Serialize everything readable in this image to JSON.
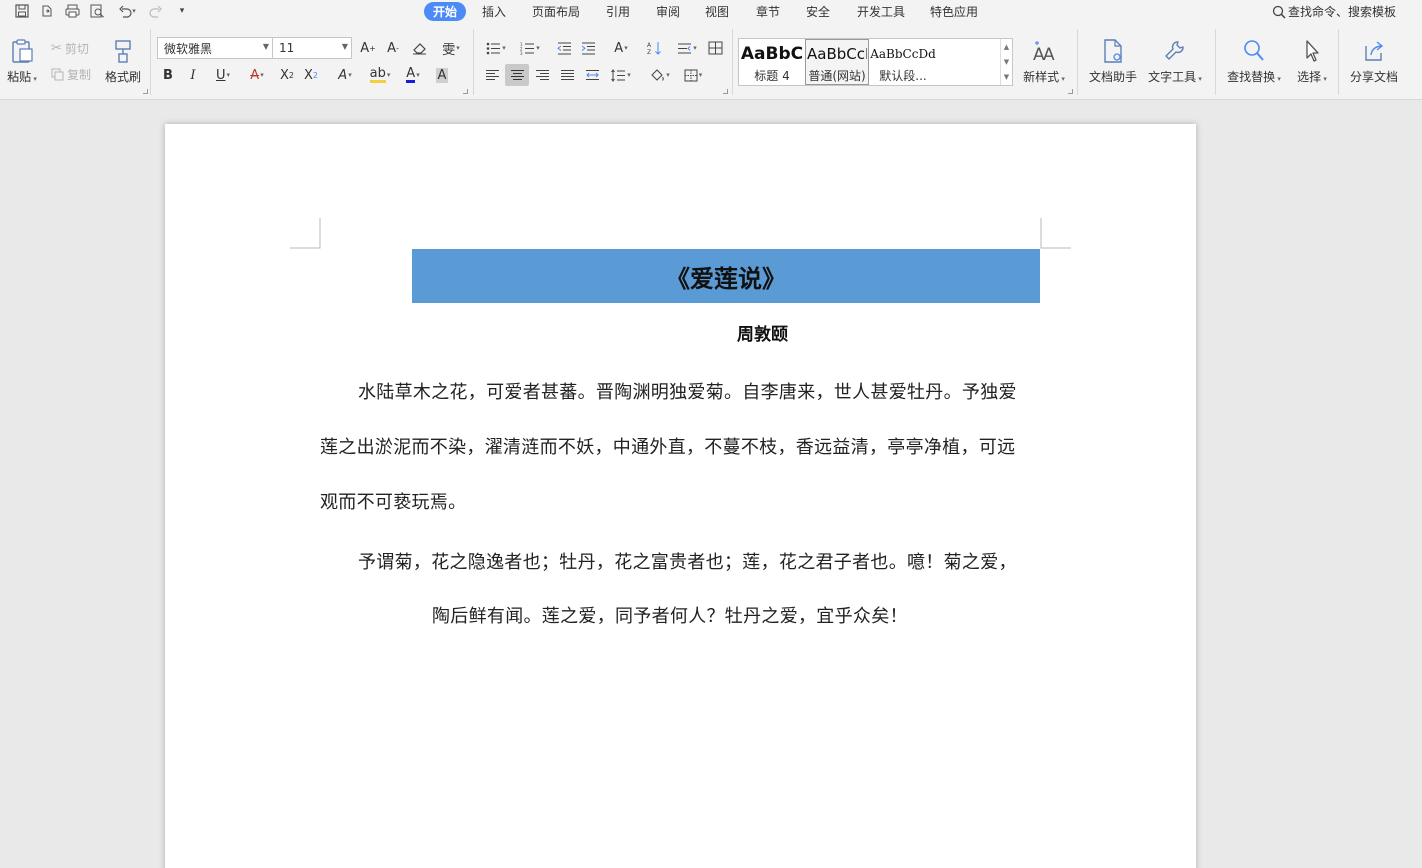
{
  "menu": {
    "tabs": [
      "开始",
      "插入",
      "页面布局",
      "引用",
      "审阅",
      "视图",
      "章节",
      "安全",
      "开发工具",
      "特色应用"
    ],
    "active_tab": "开始",
    "search_command": "查找命令、搜索模板"
  },
  "ribbon": {
    "clipboard": {
      "paste": "粘贴",
      "cut": "剪切",
      "copy": "复制",
      "format_painter": "格式刷"
    },
    "font": {
      "name": "微软雅黑",
      "size": "11"
    },
    "styles": [
      {
        "sample": "AaBbC",
        "name": "标题 4"
      },
      {
        "sample": "AaBbCcI",
        "name": "普通(网站)"
      },
      {
        "sample": "AaBbCcDd",
        "name": "默认段..."
      }
    ],
    "new_style": "新样式",
    "doc_assistant": "文档助手",
    "text_tools": "文字工具",
    "find_replace": "查找替换",
    "select": "选择",
    "share_doc": "分享文档"
  },
  "document": {
    "title": "《爱莲说》",
    "author": "周敦颐",
    "paragraph1": [
      "水陆草木之花，可爱者甚蕃。晋陶渊明独爱菊。自李唐来，世人甚爱牡丹。予独爱",
      "莲之出淤泥而不染，濯清涟而不妖，中通外直，不蔓不枝，香远益清，亭亭净植，可远",
      "观而不可亵玩焉。"
    ],
    "paragraph2": [
      "予谓菊，花之隐逸者也；牡丹，花之富贵者也；莲，花之君子者也。噫！菊之爱，",
      "陶后鲜有闻。莲之爱，同予者何人？牡丹之爱，宜乎众矣！"
    ],
    "title_bg_color": "#5b9bd5"
  },
  "colors": {
    "active_tab": "#4c8af5",
    "font_color_underline": "#1a1ae0",
    "highlight_underline": "#f4d03f"
  }
}
